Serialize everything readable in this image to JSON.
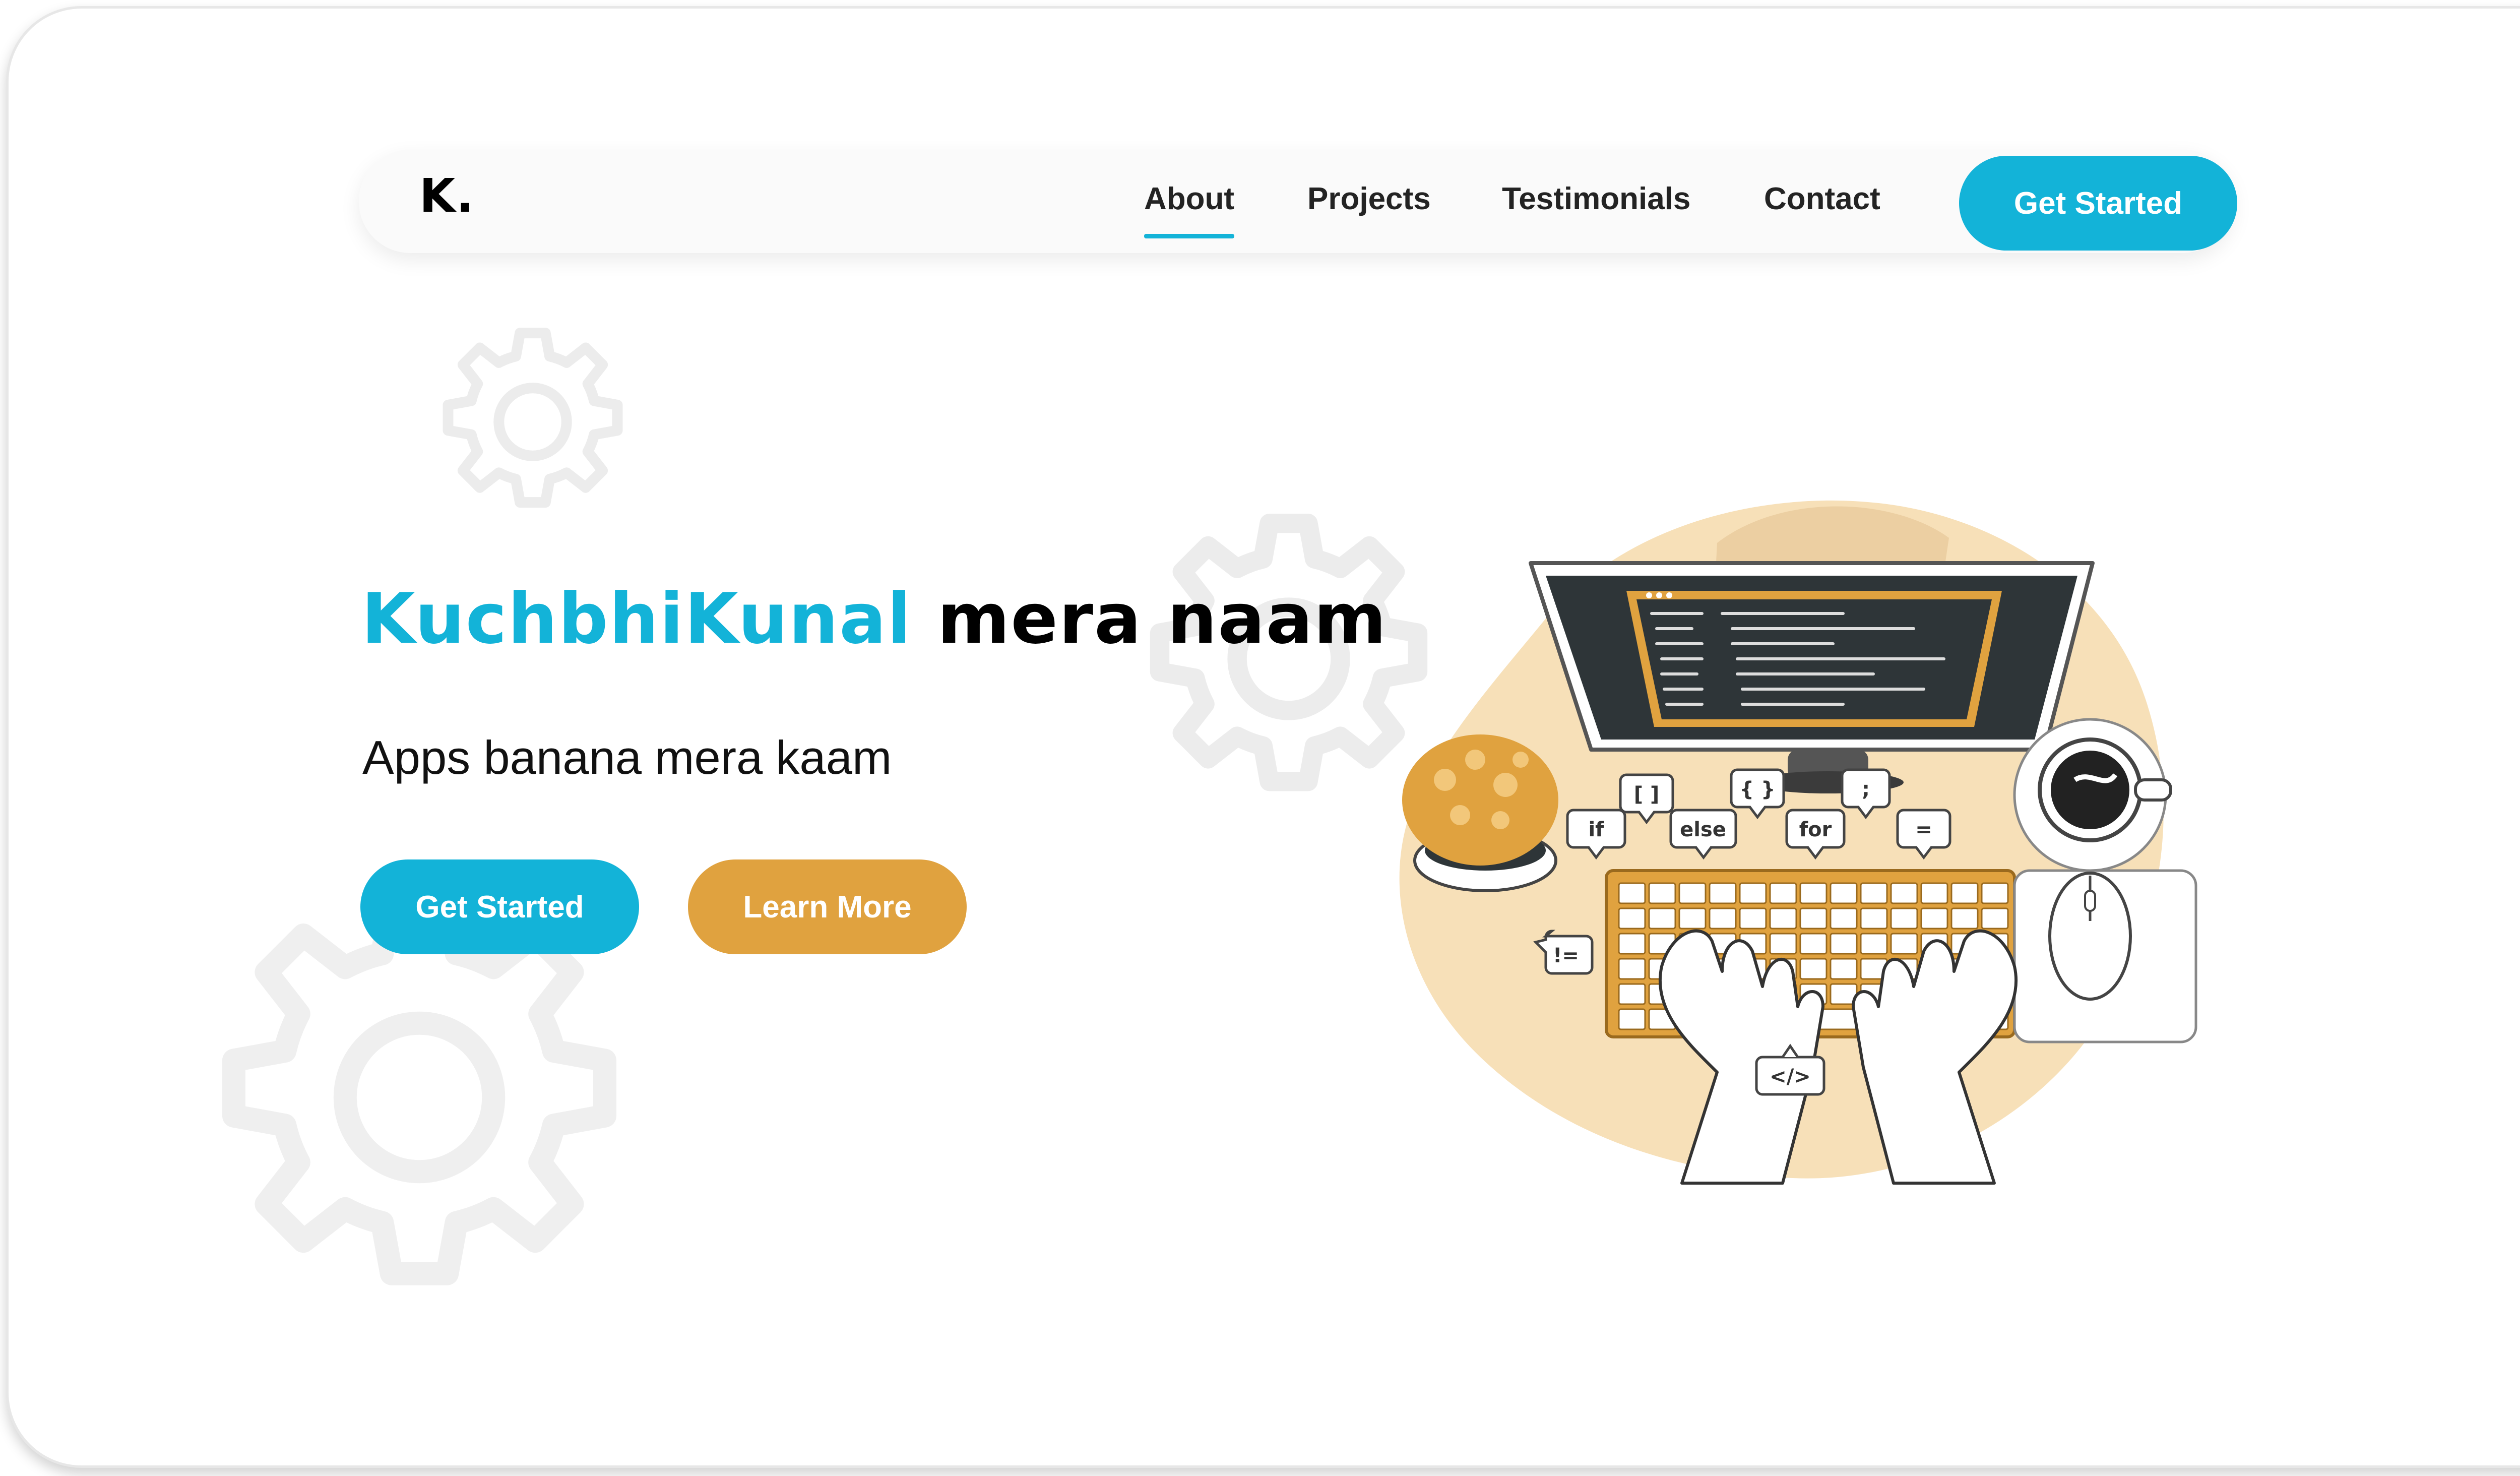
{
  "navbar": {
    "logo": "K.",
    "links": [
      "About",
      "Projects",
      "Testimonials",
      "Contact"
    ],
    "active_link": "About",
    "cta_label": "Get Started"
  },
  "hero": {
    "title_accent": "KuchbhiKunal",
    "title_rest": "mera naam",
    "subtitle": "Apps banana mera kaam",
    "primary_button": "Get Started",
    "secondary_button": "Learn More"
  },
  "illustration": {
    "code_bubbles": [
      "if",
      "[ ]",
      "else",
      "{ }",
      "for",
      ";",
      "=",
      "!=",
      "</>"
    ]
  },
  "colors": {
    "accent": "#13b3d8",
    "secondary": "#e0a23f",
    "blob": "#f7e0b8",
    "gear": "#ececec"
  }
}
